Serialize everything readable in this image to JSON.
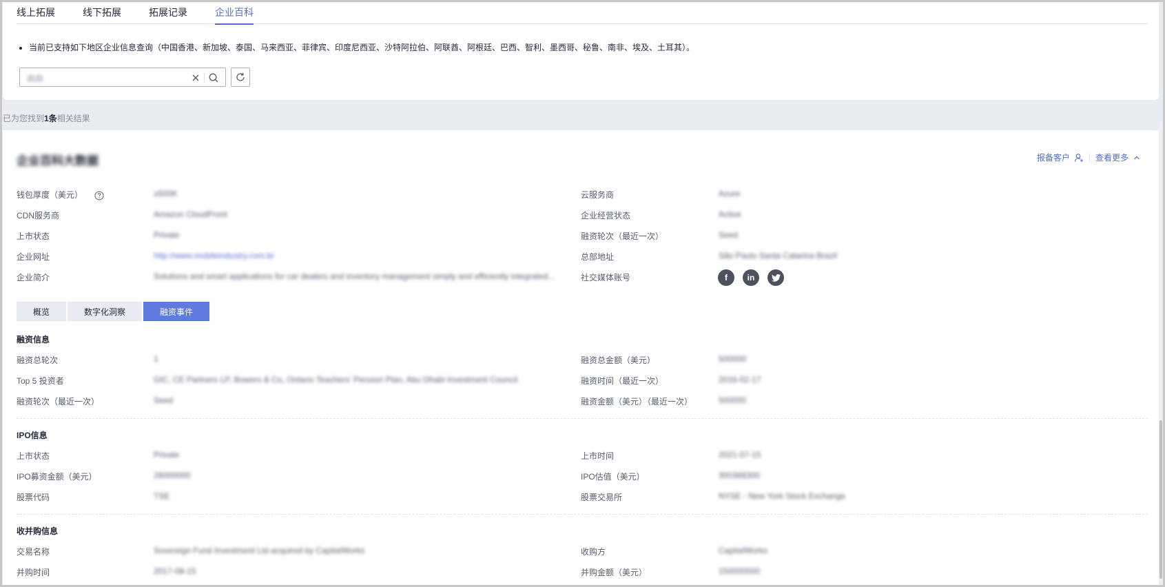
{
  "tabs": [
    {
      "label": "线上拓展"
    },
    {
      "label": "线下拓展"
    },
    {
      "label": "拓展记录"
    },
    {
      "label": "企业百科",
      "active": true
    }
  ],
  "notice": "当前已支持如下地区企业信息查询（中国香港、新加坡、泰国、马来西亚、菲律宾、印度尼西亚、沙特阿拉伯、阿联酋、阿根廷、巴西、智利、墨西哥、秘鲁、南非、埃及、土耳其）。",
  "search": {
    "value": "曲曲"
  },
  "result": {
    "prefix": "已为您找到",
    "count": "1条",
    "suffix": "相关结果"
  },
  "company": {
    "name": "企业百科大数据"
  },
  "actions": {
    "report": "报备客户",
    "more": "查看更多"
  },
  "basic": {
    "wallet_label": "钱包厚度（美元）",
    "wallet_value": "≥500K",
    "cloud_label": "云服务商",
    "cloud_value": "Azure",
    "cdn_label": "CDN服务商",
    "cdn_value": "Amazon CloudFront",
    "status_label": "企业经营状态",
    "status_value": "Active",
    "listing_label": "上市状态",
    "listing_value": "Private",
    "round_label": "融资轮次（最近一次）",
    "round_value": "Seed",
    "website_label": "企业网址",
    "website_value": "http://www.mobileindustry.com.br",
    "hq_label": "总部地址",
    "hq_value": "São Paulo Santa Catarina Brazil",
    "intro_label": "企业简介",
    "intro_value": "Solutions and smart applications for car dealers and inventory management simply and efficiently integrated...",
    "social_label": "社交媒体账号"
  },
  "subtabs": [
    {
      "label": "概览"
    },
    {
      "label": "数字化洞察"
    },
    {
      "label": "融资事件",
      "active": true
    }
  ],
  "funding": {
    "title": "融资信息",
    "total_rounds_label": "融资总轮次",
    "total_rounds_value": "1",
    "total_amount_label": "融资总金额（美元）",
    "total_amount_value": "500000",
    "investors_label": "Top 5 投资者",
    "investors_value": "GIC, CE Partners LP, Bowers & Co, Ontario Teachers' Pension Plan, Abu Dhabi Investment Council",
    "last_time_label": "融资时间（最近一次）",
    "last_time_value": "2016-02-17",
    "last_round_label": "融资轮次（最近一次）",
    "last_round_value": "Seed",
    "last_amount_label": "融资金额（美元）（最近一次）",
    "last_amount_value": "500000"
  },
  "ipo": {
    "title": "IPO信息",
    "status_label": "上市状态",
    "status_value": "Private",
    "time_label": "上市时间",
    "time_value": "2021-07-15",
    "raise_label": "IPO募资金额（美元）",
    "raise_value": "26000000",
    "valuation_label": "IPO估值（美元）",
    "valuation_value": "300368300",
    "code_label": "股票代码",
    "code_value": "TSE",
    "exchange_label": "股票交易所",
    "exchange_value": "NYSE - New York Stock Exchange"
  },
  "ma": {
    "title": "收并购信息",
    "deal_label": "交易名称",
    "deal_value": "Sovereign Fund Investment Ltd acquired by CapitalWorks",
    "acquirer_label": "收购方",
    "acquirer_value": "CapitalWorks",
    "time_label": "并购时间",
    "time_value": "2017-08-15",
    "amount_label": "并购金额（美元）",
    "amount_value": "150000000"
  },
  "colors": {
    "accent": "#526ecc",
    "active_tab_bg": "#5e7ce0"
  }
}
